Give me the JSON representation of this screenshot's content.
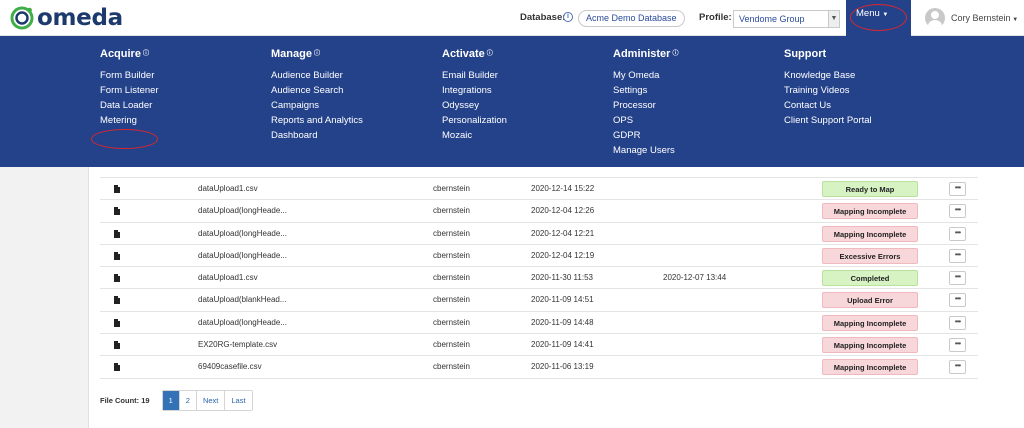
{
  "header": {
    "logo_text": "omeda",
    "database_label": "Database:",
    "database_value": "Acme Demo Database",
    "profile_label": "Profile:",
    "profile_value": "Vendome Group",
    "menu_label": "Menu",
    "user_name": "Cory Bernstein"
  },
  "mega_menu": {
    "columns": [
      {
        "heading": "Acquire",
        "items": [
          "Form Builder",
          "Form Listener",
          "Data Loader",
          "Metering"
        ]
      },
      {
        "heading": "Manage",
        "items": [
          "Audience Builder",
          "Audience Search",
          "Campaigns",
          "Reports and Analytics",
          "Dashboard"
        ]
      },
      {
        "heading": "Activate",
        "items": [
          "Email Builder",
          "Integrations",
          "Odyssey",
          "Personalization",
          "Mozaic"
        ]
      },
      {
        "heading": "Administer",
        "items": [
          "My Omeda",
          "Settings",
          "Processor",
          "OPS",
          "GDPR",
          "Manage Users"
        ]
      },
      {
        "heading": "Support",
        "items": [
          "Knowledge Base",
          "Training Videos",
          "Contact Us",
          "Client Support Portal"
        ]
      }
    ]
  },
  "table": {
    "rows": [
      {
        "name": "dataUpload1.csv",
        "user": "cbernstein",
        "uploaded": "2020-12-14 15:22",
        "completed": "",
        "status": "Ready to Map",
        "status_color": "#d7f3c4"
      },
      {
        "name": "dataUpload(longHeade...",
        "user": "cbernstein",
        "uploaded": "2020-12-04 12:26",
        "completed": "",
        "status": "Mapping Incomplete",
        "status_color": "#f8d7da"
      },
      {
        "name": "dataUpload(longHeade...",
        "user": "cbernstein",
        "uploaded": "2020-12-04 12:21",
        "completed": "",
        "status": "Mapping Incomplete",
        "status_color": "#f8d7da"
      },
      {
        "name": "dataUpload(longHeade...",
        "user": "cbernstein",
        "uploaded": "2020-12-04 12:19",
        "completed": "",
        "status": "Excessive Errors",
        "status_color": "#f8d7da"
      },
      {
        "name": "dataUpload1.csv",
        "user": "cbernstein",
        "uploaded": "2020-11-30 11:53",
        "completed": "2020-12-07 13:44",
        "status": "Completed",
        "status_color": "#d7f3c4"
      },
      {
        "name": "dataUpload(blankHead...",
        "user": "cbernstein",
        "uploaded": "2020-11-09 14:51",
        "completed": "",
        "status": "Upload Error",
        "status_color": "#f8d7da"
      },
      {
        "name": "dataUpload(longHeade...",
        "user": "cbernstein",
        "uploaded": "2020-11-09 14:48",
        "completed": "",
        "status": "Mapping Incomplete",
        "status_color": "#f8d7da"
      },
      {
        "name": "EX20RG-template.csv",
        "user": "cbernstein",
        "uploaded": "2020-11-09 14:41",
        "completed": "",
        "status": "Mapping Incomplete",
        "status_color": "#f8d7da"
      },
      {
        "name": "69409casefile.csv",
        "user": "cbernstein",
        "uploaded": "2020-11-06 13:19",
        "completed": "",
        "status": "Mapping Incomplete",
        "status_color": "#f8d7da"
      }
    ],
    "row_menu_label": "•••"
  },
  "footer": {
    "file_count": "File Count: 19",
    "pages": [
      "1",
      "2",
      "Next",
      "Last"
    ],
    "active_page": "1"
  },
  "colors": {
    "brand_navy": "#24428a",
    "highlight_red": "#d9262e",
    "logo_green": "#3fae49"
  }
}
